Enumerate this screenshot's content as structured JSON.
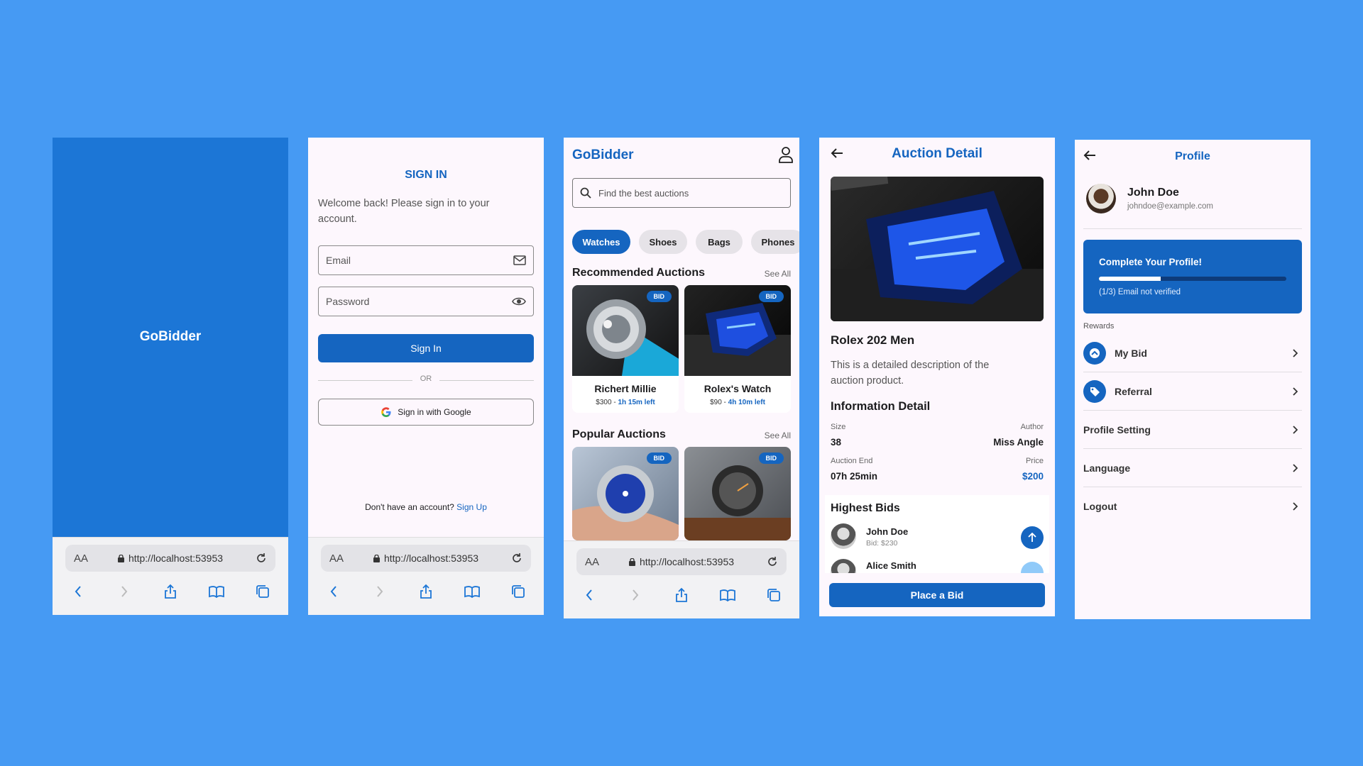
{
  "safari": {
    "aa": "AA",
    "url": "http://localhost:53953"
  },
  "splash": {
    "brand": "GoBidder"
  },
  "signin": {
    "title": "SIGN IN",
    "welcome": "Welcome back! Please sign in to your account.",
    "email_placeholder": "Email",
    "password_placeholder": "Password",
    "signin_button": "Sign In",
    "or": "OR",
    "google_button": "Sign in with Google",
    "no_account": "Don't have an account?",
    "signup_link": "Sign Up"
  },
  "home": {
    "brand": "GoBidder",
    "search_placeholder": "Find the best auctions",
    "categories": [
      "Watches",
      "Shoes",
      "Bags",
      "Phones"
    ],
    "recommended_title": "Recommended Auctions",
    "popular_title": "Popular Auctions",
    "see_all": "See All",
    "bid_badge": "BID",
    "recommended": [
      {
        "title": "Richert Millie",
        "price": "$300 - ",
        "time": "1h 15m left"
      },
      {
        "title": "Rolex's Watch",
        "price": "$90 - ",
        "time": "4h 10m left"
      }
    ]
  },
  "detail": {
    "title": "Auction Detail",
    "product": "Rolex 202 Men",
    "description": "This is a detailed description of the auction product.",
    "info_title": "Information Detail",
    "size_label": "Size",
    "size_value": "38",
    "author_label": "Author",
    "author_value": "Miss Angle",
    "end_label": "Auction End",
    "end_value": "07h 25min",
    "price_label": "Price",
    "price_value": "$200",
    "highest_bids_title": "Highest Bids",
    "bids": [
      {
        "name": "John Doe",
        "bid": "Bid: $230"
      },
      {
        "name": "Alice Smith"
      }
    ],
    "place_bid": "Place a Bid"
  },
  "profile": {
    "title": "Profile",
    "name": "John Doe",
    "email": "johndoe@example.com",
    "complete_title": "Complete Your Profile!",
    "complete_progress": 0.33,
    "complete_status": "(1/3) Email not verified",
    "rewards_label": "Rewards",
    "menu": [
      "My Bid",
      "Referral",
      "Profile Setting",
      "Language",
      "Logout"
    ]
  },
  "colors": {
    "background": "#469af3",
    "primary": "#1565c0",
    "splash": "#1c76d6"
  }
}
